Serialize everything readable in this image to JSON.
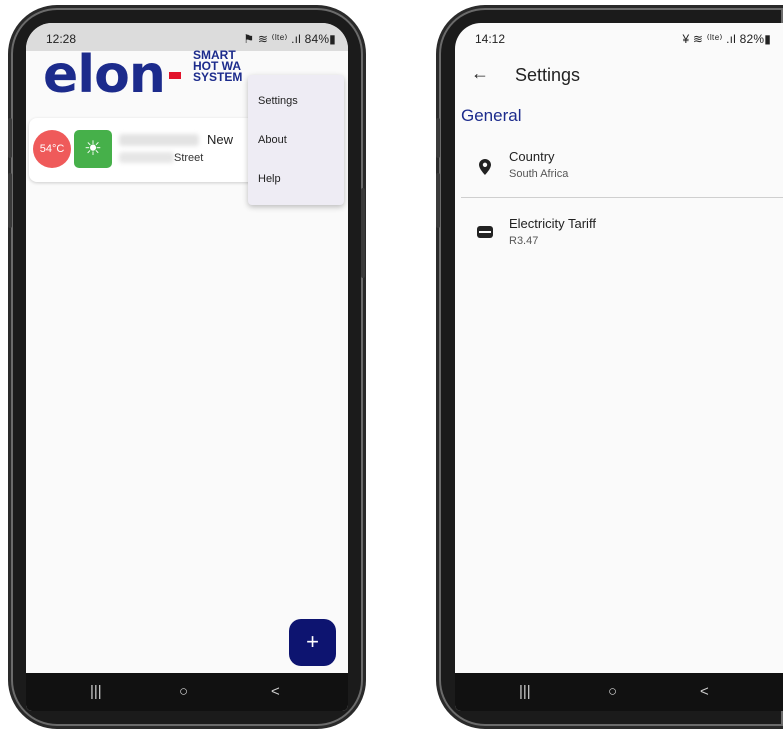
{
  "left_phone": {
    "status": {
      "time": "12:28",
      "icons": "⚑ ≋ ⁽ˡᵗᵉ⁾ .ıl 84%▮"
    },
    "logo": {
      "text": "elon",
      "tagline": "SMART\nHOT WA\nSYSTEM"
    },
    "device_card": {
      "temperature": "54°C",
      "name_suffix": "New",
      "street": "Street"
    },
    "menu": {
      "items": [
        "Settings",
        "About",
        "Help"
      ]
    },
    "fab_label": "+",
    "nav": {
      "recent": "|||",
      "home": "○",
      "back": "<"
    }
  },
  "right_phone": {
    "status": {
      "time": "14:12",
      "icons": "¥ ≋ ⁽ˡᵗᵉ⁾ .ıl 82%▮"
    },
    "appbar": {
      "back": "←",
      "title": "Settings"
    },
    "section": "General",
    "rows": [
      {
        "label": "Country",
        "value": "South Africa",
        "icon": "location-pin-icon"
      },
      {
        "label": "Electricity Tariff",
        "value": "R3.47",
        "icon": "wallet-icon"
      }
    ],
    "nav": {
      "recent": "|||",
      "home": "○",
      "back": "<"
    }
  },
  "colors": {
    "brand_blue": "#1c2b8c",
    "brand_red": "#e2132b",
    "fab": "#0d1470",
    "temp_badge": "#ef5a5a",
    "mode_badge": "#46b04a"
  }
}
